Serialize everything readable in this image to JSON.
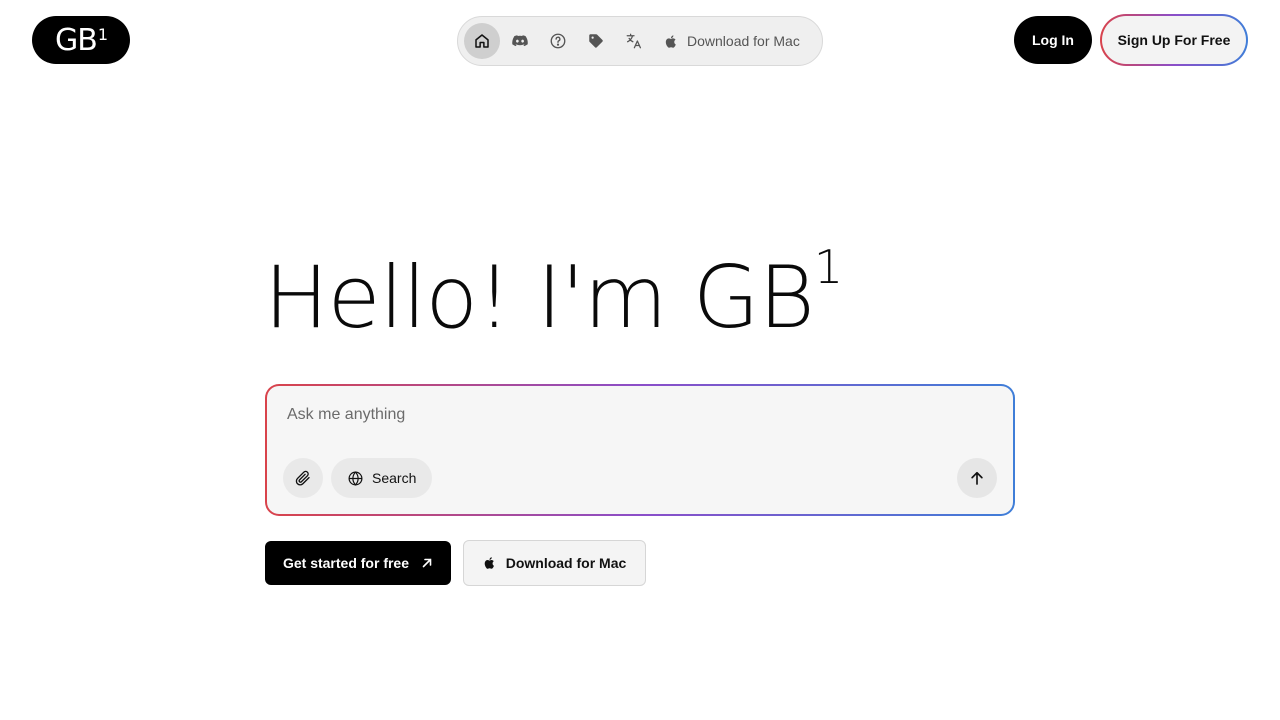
{
  "brand": {
    "logo_text": "GB",
    "logo_sup": "1"
  },
  "nav": {
    "items": [
      {
        "icon": "home-icon",
        "active": true
      },
      {
        "icon": "discord-icon",
        "active": false
      },
      {
        "icon": "help-circle-icon",
        "active": false
      },
      {
        "icon": "tag-icon",
        "active": false
      },
      {
        "icon": "translate-icon",
        "active": false
      }
    ],
    "download_label": "Download for Mac"
  },
  "auth": {
    "login_label": "Log In",
    "signup_label": "Sign Up For Free"
  },
  "hero": {
    "title": "Hello! I'm GB",
    "title_sup": "1"
  },
  "prompt": {
    "placeholder": "Ask me anything",
    "value": "",
    "search_label": "Search"
  },
  "cta": {
    "primary_label": "Get started for free",
    "secondary_label": "Download for Mac"
  },
  "colors": {
    "gradient_start": "#d9434b",
    "gradient_mid": "#8b4ec9",
    "gradient_end": "#3f7ed8"
  }
}
